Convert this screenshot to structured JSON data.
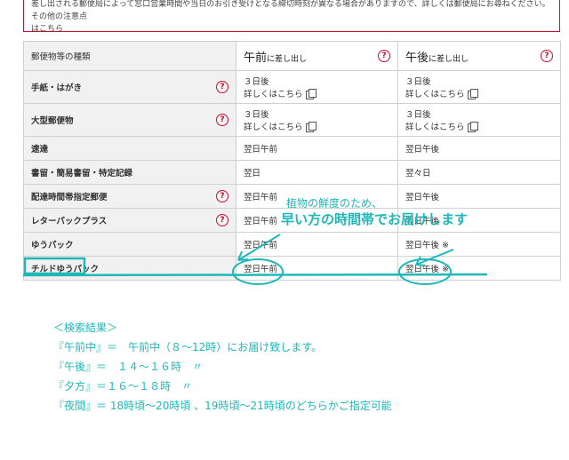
{
  "notice": {
    "line1": "差し出される郵便局によって窓口営業時間や当日のお引き受けとなる締切時刻が異なる場合がありますので、詳しくは郵便局にお尋ねください。その他の注意点",
    "line2": "はこちら"
  },
  "table": {
    "headers": {
      "type": "郵便物等の種類",
      "am_main": "午前",
      "am_sub": "に差し出し",
      "pm_main": "午後",
      "pm_sub": "に差し出し"
    },
    "rows": [
      {
        "type": "手紙・はがき",
        "help": true,
        "am": "３日後",
        "am_link": "詳しくはこちら",
        "pm": "３日後",
        "pm_link": "詳しくはこちら"
      },
      {
        "type": "大型郵便物",
        "help": true,
        "am": "３日後",
        "am_link": "詳しくはこちら",
        "pm": "３日後",
        "pm_link": "詳しくはこちら"
      },
      {
        "type": "速達",
        "help": false,
        "am": "翌日午前",
        "pm": "翌日午後"
      },
      {
        "type": "書留・簡易書留・特定記録",
        "help": false,
        "am": "翌日",
        "pm": "翌々日"
      },
      {
        "type": "配達時間帯指定郵便",
        "help": true,
        "am": "翌日午前",
        "pm": "翌日午後"
      },
      {
        "type": "レターパックプラス",
        "help": true,
        "am": "翌日午前",
        "pm": "翌日午後"
      },
      {
        "type": "ゆうパック",
        "help": false,
        "am": "翌日午前",
        "pm": "翌日午後 ※"
      },
      {
        "type": "チルドゆうパック",
        "help": false,
        "am": "翌日午前",
        "pm": "翌日午後 ※"
      }
    ],
    "help_glyph": "?"
  },
  "annotation": {
    "line1": "植物の鮮度のため、",
    "line2": "早い方の時間帯でお届けします"
  },
  "results": {
    "heading": "＜検索結果＞",
    "lines": [
      "『午前中』＝　午前中（８～12時）にお届け致します。",
      "『午後』＝　１４～１６時　〃",
      "『夕方』＝１６～１８時　〃",
      "『夜間』＝ 18時頃～20時頃 、19時頃～21時頃のどちらかご指定可能"
    ]
  },
  "colors": {
    "accent_red": "#c8102e",
    "annotation_teal": "#1eb8b8",
    "header_bg": "#f1f1f1"
  },
  "icons": {
    "help": "question-circle-icon",
    "link": "document-copy-icon"
  }
}
